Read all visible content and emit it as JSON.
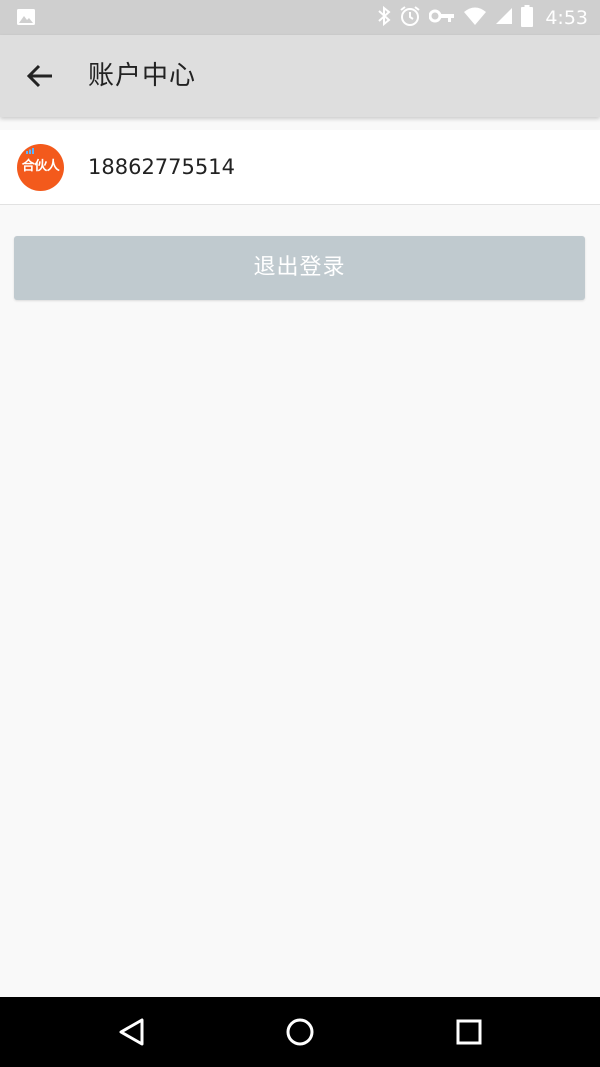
{
  "status_bar": {
    "time": "4:53",
    "icons": [
      "image-icon",
      "bluetooth-icon",
      "alarm-icon",
      "vpn-key-icon",
      "wifi-icon",
      "signal-icon",
      "battery-icon"
    ]
  },
  "app_bar": {
    "title": "账户中心",
    "back_icon": "arrow-back-icon"
  },
  "account": {
    "avatar_text": "合伙人",
    "phone": "18862775514"
  },
  "logout": {
    "label": "退出登录"
  },
  "nav_bar": {
    "icons": [
      "back-triangle-icon",
      "home-circle-icon",
      "recents-square-icon"
    ]
  },
  "colors": {
    "status_bar": "#cfcfcf",
    "app_bar": "#dedede",
    "background": "#f9f9f9",
    "avatar": "#f35a1c",
    "logout_button": "#c0cacf",
    "nav_bar": "#000000"
  }
}
